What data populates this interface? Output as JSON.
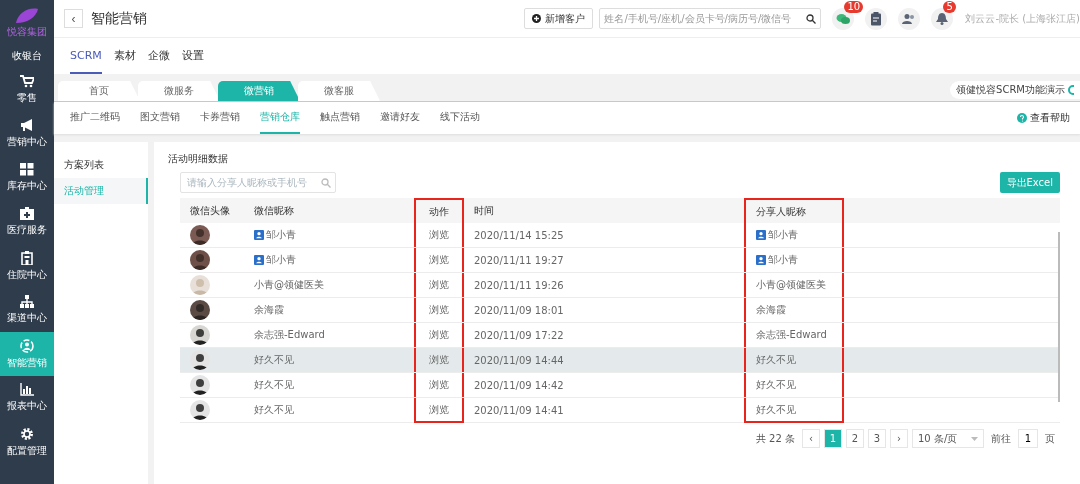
{
  "sidebar": {
    "logo_text": "悦容集团",
    "items": [
      {
        "label": "收银台",
        "selected": false
      },
      {
        "label": "零售",
        "selected": false
      },
      {
        "label": "营销中心",
        "selected": false
      },
      {
        "label": "库存中心",
        "selected": false
      },
      {
        "label": "医疗服务",
        "selected": false
      },
      {
        "label": "住院中心",
        "selected": false
      },
      {
        "label": "渠道中心",
        "selected": false
      },
      {
        "label": "智能营销",
        "selected": true
      },
      {
        "label": "报表中心",
        "selected": false
      },
      {
        "label": "配置管理",
        "selected": false
      }
    ]
  },
  "header": {
    "back": "‹",
    "title": "智能营销",
    "add_button": "新增客户",
    "search_placeholder": "姓名/手机号/座机/会员卡号/病历号/微信号",
    "icons": [
      {
        "kind": "chat",
        "badge": "10"
      },
      {
        "kind": "clipboard"
      },
      {
        "kind": "users"
      },
      {
        "kind": "bell",
        "badge": "5"
      }
    ],
    "user": "刘云云-院长 (上海张江店)"
  },
  "top_tabs": [
    {
      "label": "SCRM",
      "selected": true
    },
    {
      "label": "素材",
      "selected": false
    },
    {
      "label": "企微",
      "selected": false
    },
    {
      "label": "设置",
      "selected": false
    }
  ],
  "module_tabs": [
    {
      "label": "首页",
      "selected": false
    },
    {
      "label": "微服务",
      "selected": false
    },
    {
      "label": "微营销",
      "selected": true
    },
    {
      "label": "微客服",
      "selected": false
    }
  ],
  "demo_pill": "领健悦容SCRM功能演示",
  "sub_tabs": [
    {
      "label": "推广二维码",
      "selected": false
    },
    {
      "label": "图文营销",
      "selected": false
    },
    {
      "label": "卡券营销",
      "selected": false
    },
    {
      "label": "营销仓库",
      "selected": true
    },
    {
      "label": "触点营销",
      "selected": false
    },
    {
      "label": "邀请好友",
      "selected": false
    },
    {
      "label": "线下活动",
      "selected": false
    }
  ],
  "help": "查看帮助",
  "side_menu": [
    {
      "label": "方案列表",
      "selected": false
    },
    {
      "label": "活动管理",
      "selected": true
    }
  ],
  "panel": {
    "title": "活动明细数据",
    "search_placeholder": "请输入分享人昵称或手机号",
    "export_button": "导出Excel"
  },
  "table": {
    "columns": [
      {
        "label": "微信头像",
        "highlighted": false
      },
      {
        "label": "微信昵称",
        "highlighted": false
      },
      {
        "label": "动作",
        "highlighted": true
      },
      {
        "label": "时间",
        "highlighted": false
      },
      {
        "label": "分享人昵称",
        "highlighted": true
      }
    ],
    "rows": [
      {
        "nickname": "邹小青",
        "nickname_badge": true,
        "action": "浏览",
        "time": "2020/11/14 15:25",
        "sharer": "邹小青",
        "sharer_badge": true,
        "striped": false
      },
      {
        "nickname": "邹小青",
        "nickname_badge": true,
        "action": "浏览",
        "time": "2020/11/11 19:27",
        "sharer": "邹小青",
        "sharer_badge": true,
        "striped": false
      },
      {
        "nickname": "小青@领健医美",
        "nickname_badge": false,
        "action": "浏览",
        "time": "2020/11/11 19:26",
        "sharer": "小青@领健医美",
        "sharer_badge": false,
        "striped": false
      },
      {
        "nickname": "余海霞",
        "nickname_badge": false,
        "action": "浏览",
        "time": "2020/11/09 18:01",
        "sharer": "余海霞",
        "sharer_badge": false,
        "striped": false
      },
      {
        "nickname": "余志强-Edward",
        "nickname_badge": false,
        "action": "浏览",
        "time": "2020/11/09 17:22",
        "sharer": "余志强-Edward",
        "sharer_badge": false,
        "striped": false
      },
      {
        "nickname": "好久不见",
        "nickname_badge": false,
        "action": "浏览",
        "time": "2020/11/09 14:44",
        "sharer": "好久不见",
        "sharer_badge": false,
        "striped": true
      },
      {
        "nickname": "好久不见",
        "nickname_badge": false,
        "action": "浏览",
        "time": "2020/11/09 14:42",
        "sharer": "好久不见",
        "sharer_badge": false,
        "striped": false
      },
      {
        "nickname": "好久不见",
        "nickname_badge": false,
        "action": "浏览",
        "time": "2020/11/09 14:41",
        "sharer": "好久不见",
        "sharer_badge": false,
        "striped": false
      }
    ]
  },
  "pagination": {
    "total": "共 22 条",
    "prev": "‹",
    "pages": [
      {
        "label": "1",
        "selected": true
      },
      {
        "label": "2",
        "selected": false
      },
      {
        "label": "3",
        "selected": false
      }
    ],
    "next": "›",
    "page_size": "10 条/页",
    "goto_label": "前往",
    "goto_value": "1",
    "goto_suffix": "页"
  }
}
